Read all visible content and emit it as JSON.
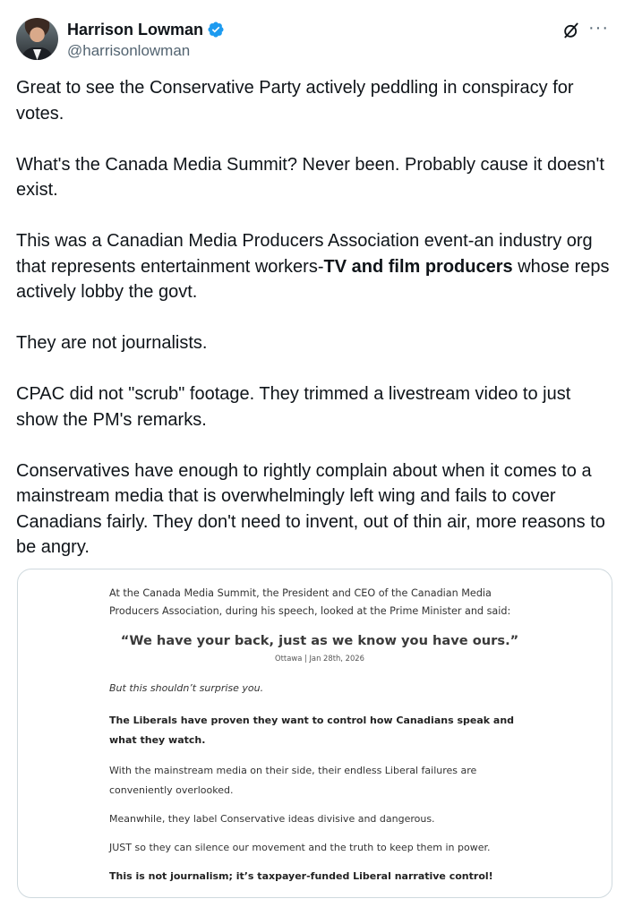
{
  "author": {
    "display_name": "Harrison Lowman",
    "handle": "@harrisonlowman",
    "verified": true
  },
  "icons": {
    "verified": "verified-badge-icon",
    "grok": "grok-icon",
    "more": "more-options-icon"
  },
  "colors": {
    "verified_blue": "#1d9bf0",
    "text": "#0f1419",
    "secondary_text": "#536471"
  },
  "tweet": {
    "p1": "Great to see the Conservative Party actively peddling in conspiracy for votes.",
    "p2": "What's the Canada Media Summit? Never been. Probably cause it doesn't exist.",
    "p3_before": "This was a Canadian Media Producers Association event-an industry org that represents entertainment workers-",
    "p3_bold": "TV and film producers",
    "p3_after": " whose reps actively lobby the govt.",
    "p4": "They are not journalists.",
    "p5": "CPAC did not \"scrub\" footage. They trimmed a livestream video to just show the PM's remarks.",
    "p6": "Conservatives have enough to rightly complain about when it comes to a mainstream media that is overwhelmingly left wing and fails to cover Canadians fairly. They don't need to invent, out of thin air, more reasons to be angry."
  },
  "media": {
    "intro": "At the Canada Media Summit, the President and CEO of the Canadian Media Producers Association, during his speech, looked at the Prime Minister and said:",
    "quote": "“We have your back, just as we know you have ours.”",
    "dateline": "Ottawa | Jan 28th, 2026",
    "line1": "But this shouldn’t surprise you.",
    "line2": "The Liberals have proven they want to control how Canadians speak and what they watch.",
    "line3": "With the mainstream media on their side, their endless Liberal failures are conveniently overlooked.",
    "line4": "Meanwhile, they label Conservative ideas divisive and dangerous.",
    "line5": "JUST so they can silence our movement and the truth to keep them in power.",
    "line6": "This is not journalism; it’s taxpayer-funded Liberal narrative control!"
  }
}
